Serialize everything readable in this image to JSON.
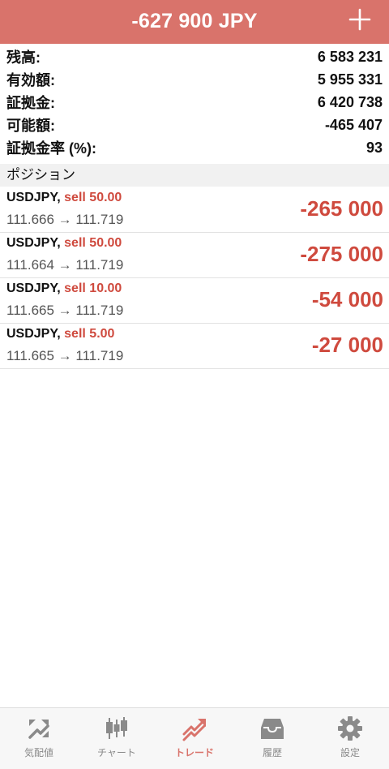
{
  "header": {
    "title": "-627 900 JPY",
    "add_icon": "plus-icon"
  },
  "summary": [
    {
      "label": "残高:",
      "value": "6 583 231"
    },
    {
      "label": "有効額:",
      "value": "5 955 331"
    },
    {
      "label": "証拠金:",
      "value": "6 420 738"
    },
    {
      "label": "可能額:",
      "value": "-465 407"
    },
    {
      "label": "証拠金率 (%):",
      "value": "93"
    }
  ],
  "positions_section": {
    "title": "ポジション"
  },
  "positions": [
    {
      "symbol": "USDJPY,",
      "side": "sell 50.00",
      "prices": "111.666 → 111.719",
      "profit": "-265 000"
    },
    {
      "symbol": "USDJPY,",
      "side": "sell 50.00",
      "prices": "111.664 → 111.719",
      "profit": "-275 000"
    },
    {
      "symbol": "USDJPY,",
      "side": "sell 10.00",
      "prices": "111.665 → 111.719",
      "profit": "-54 000"
    },
    {
      "symbol": "USDJPY,",
      "side": "sell 5.00",
      "prices": "111.665 → 111.719",
      "profit": "-27 000"
    }
  ],
  "tabbar": {
    "tabs": [
      {
        "label": "気配値",
        "icon": "quotes-icon",
        "active": false
      },
      {
        "label": "チャート",
        "icon": "chart-icon",
        "active": false
      },
      {
        "label": "トレード",
        "icon": "trade-icon",
        "active": true
      },
      {
        "label": "履歴",
        "icon": "history-icon",
        "active": false
      },
      {
        "label": "設定",
        "icon": "settings-icon",
        "active": false
      }
    ]
  },
  "colors": {
    "accent": "#d9736b",
    "loss": "#cf4a3e",
    "tab_inactive": "#8a8a8a"
  }
}
